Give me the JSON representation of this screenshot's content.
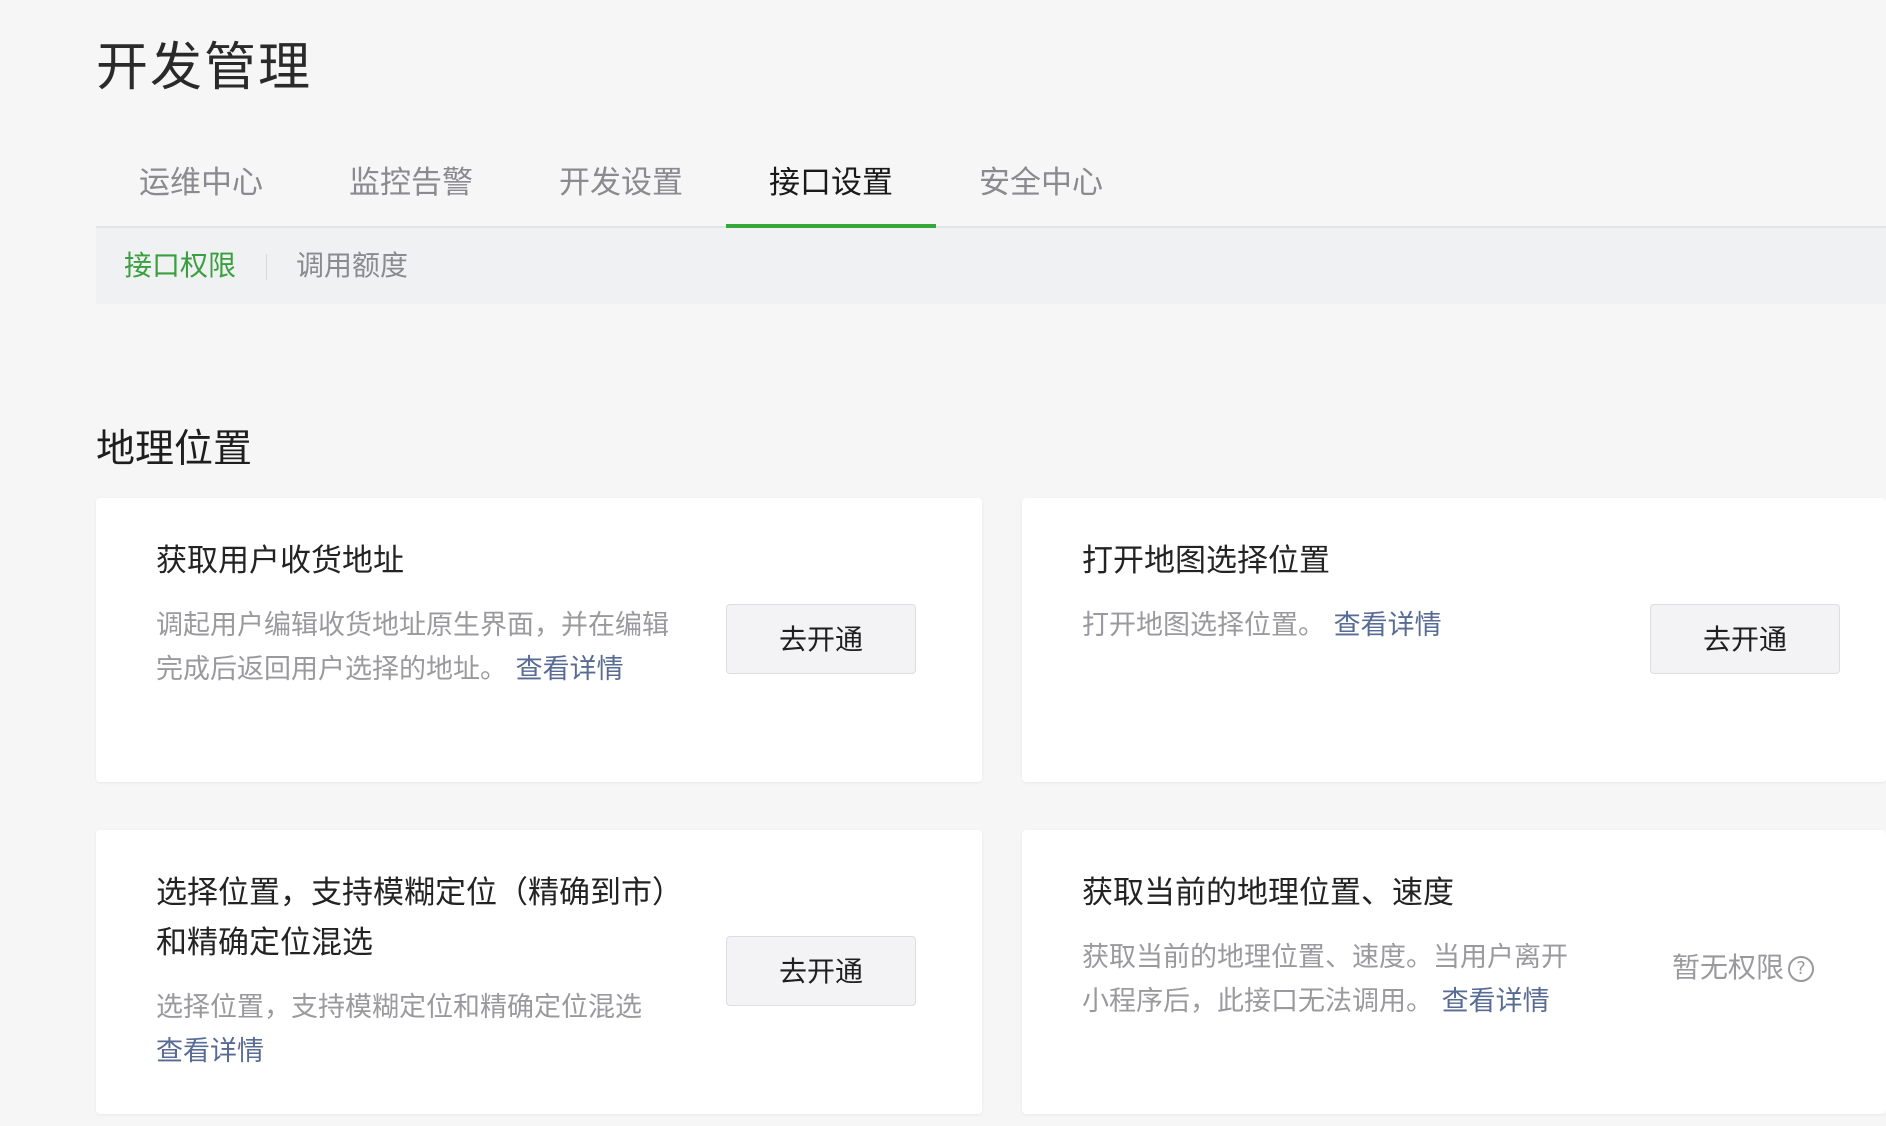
{
  "page": {
    "title": "开发管理"
  },
  "tabs": [
    {
      "label": "运维中心"
    },
    {
      "label": "监控告警"
    },
    {
      "label": "开发设置"
    },
    {
      "label": "接口设置"
    },
    {
      "label": "安全中心"
    }
  ],
  "active_tab": "接口设置",
  "subtabs": [
    {
      "label": "接口权限"
    },
    {
      "label": "调用额度"
    }
  ],
  "active_subtab": "接口权限",
  "section": {
    "title": "地理位置"
  },
  "cards": [
    {
      "title": "获取用户收货地址",
      "desc": "调起用户编辑收货地址原生界面，并在编辑完成后返回用户选择的地址。",
      "link": "查看详情",
      "action": "去开通"
    },
    {
      "title": "打开地图选择位置",
      "desc": "打开地图选择位置。",
      "link": "查看详情",
      "action": "去开通"
    },
    {
      "title": "选择位置，支持模糊定位（精确到市）和精确定位混选",
      "desc": "选择位置，支持模糊定位和精确定位混选",
      "link": "查看详情",
      "action": "去开通"
    },
    {
      "title": "获取当前的地理位置、速度",
      "desc": "获取当前的地理位置、速度。当用户离开小程序后，此接口无法调用。",
      "link": "查看详情",
      "status": "暂无权限",
      "status_icon": "help-circle-icon"
    }
  ],
  "colors": {
    "accent_green": "#36a83b",
    "link_blue": "#576b95",
    "background": "#f6f6f7"
  }
}
